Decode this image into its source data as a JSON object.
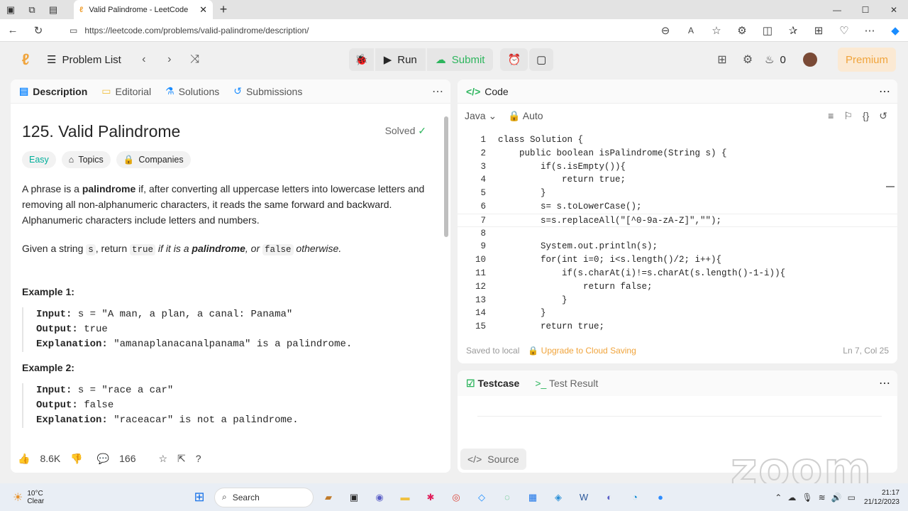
{
  "browser": {
    "tab_title": "Valid Palindrome - LeetCode",
    "url": "https://leetcode.com/problems/valid-palindrome/description/"
  },
  "header": {
    "problem_list": "Problem List",
    "run": "Run",
    "submit": "Submit",
    "streak": "0",
    "premium": "Premium"
  },
  "left_tabs": [
    "Description",
    "Editorial",
    "Solutions",
    "Submissions"
  ],
  "problem": {
    "title": "125. Valid Palindrome",
    "solved": "Solved",
    "difficulty": "Easy",
    "topics": "Topics",
    "companies": "Companies",
    "p1_a": "A phrase is a ",
    "p1_b": "palindrome",
    "p1_c": " if, after converting all uppercase letters into lowercase letters and removing all non-alphanumeric characters, it reads the same forward and backward. Alphanumeric characters include letters and numbers.",
    "p2_a": "Given a string ",
    "p2_s": "s",
    "p2_b": ", return ",
    "p2_true": "true",
    "p2_c": " if it is a ",
    "p2_d": "palindrome",
    "p2_e": ", or ",
    "p2_false": "false",
    "p2_f": " otherwise.",
    "ex1_title": "Example 1:",
    "ex1_input_label": "Input:",
    "ex1_input": " s = \"A man, a plan, a canal: Panama\"",
    "ex1_output_label": "Output:",
    "ex1_output": " true",
    "ex1_expl_label": "Explanation:",
    "ex1_expl": " \"amanaplanacanalpanama\" is a palindrome.",
    "ex2_title": "Example 2:",
    "ex2_input_label": "Input:",
    "ex2_input": " s = \"race a car\"",
    "ex2_output_label": "Output:",
    "ex2_output": " false",
    "ex2_expl_label": "Explanation:",
    "ex2_expl": " \"raceacar\" is not a palindrome."
  },
  "stats": {
    "likes": "8.6K",
    "comments": "166"
  },
  "code": {
    "header": "Code",
    "language": "Java",
    "mode": "Auto",
    "lines": [
      "class Solution {",
      "    public boolean isPalindrome(String s) {",
      "        if(s.isEmpty()){",
      "            return true;",
      "        }",
      "        s= s.toLowerCase();",
      "        s=s.replaceAll(\"[^0-9a-zA-Z]\",\"\");",
      "",
      "        System.out.println(s);",
      "        for(int i=0; i<s.length()/2; i++){",
      "            if(s.charAt(i)!=s.charAt(s.length()-1-i)){",
      "                return false;",
      "            }",
      "        }",
      "        return true;"
    ],
    "saved": "Saved to local",
    "upgrade": "Upgrade to Cloud Saving",
    "position": "Ln 7, Col 25"
  },
  "test": {
    "testcase": "Testcase",
    "result": "Test Result",
    "source": "Source"
  },
  "taskbar": {
    "temp": "10°C",
    "condition": "Clear",
    "search": "Search",
    "time": "21:17",
    "date": "21/12/2023"
  },
  "watermark": "zoom"
}
